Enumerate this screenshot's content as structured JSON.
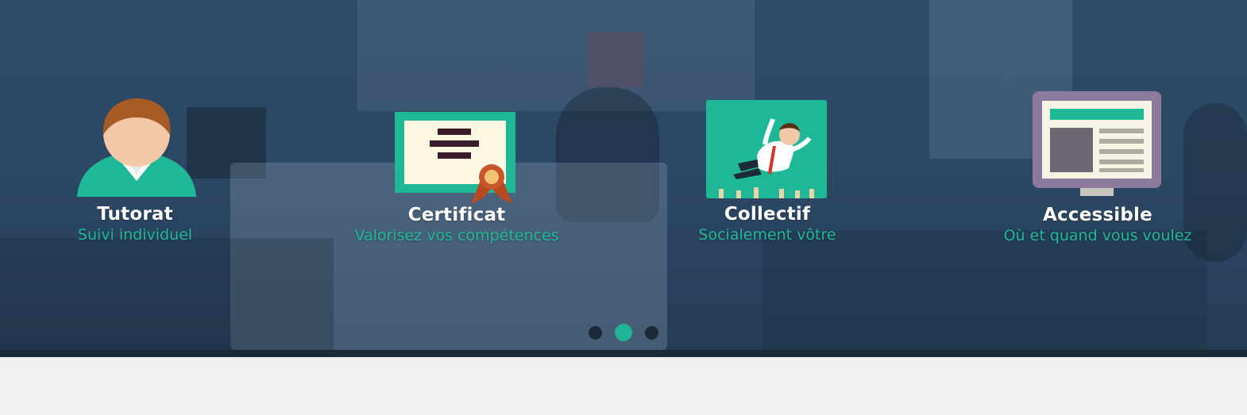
{
  "features": [
    {
      "title": "Tutorat",
      "subtitle": "Suivi individuel",
      "icon": "tutor-avatar-icon"
    },
    {
      "title": "Certificat",
      "subtitle": "Valorisez vos compétences",
      "icon": "certificate-icon"
    },
    {
      "title": "Collectif",
      "subtitle": "Socialement vôtre",
      "icon": "crowd-surf-icon"
    },
    {
      "title": "Accessible",
      "subtitle": "Où et quand vous voulez",
      "icon": "monitor-icon"
    }
  ],
  "carousel": {
    "slide_count": 3,
    "active_slide": 2
  },
  "colors": {
    "accent": "#20b497",
    "overlay": "#2e4966",
    "bar": "#1c2a38",
    "page_background": "#f0f0f0"
  }
}
